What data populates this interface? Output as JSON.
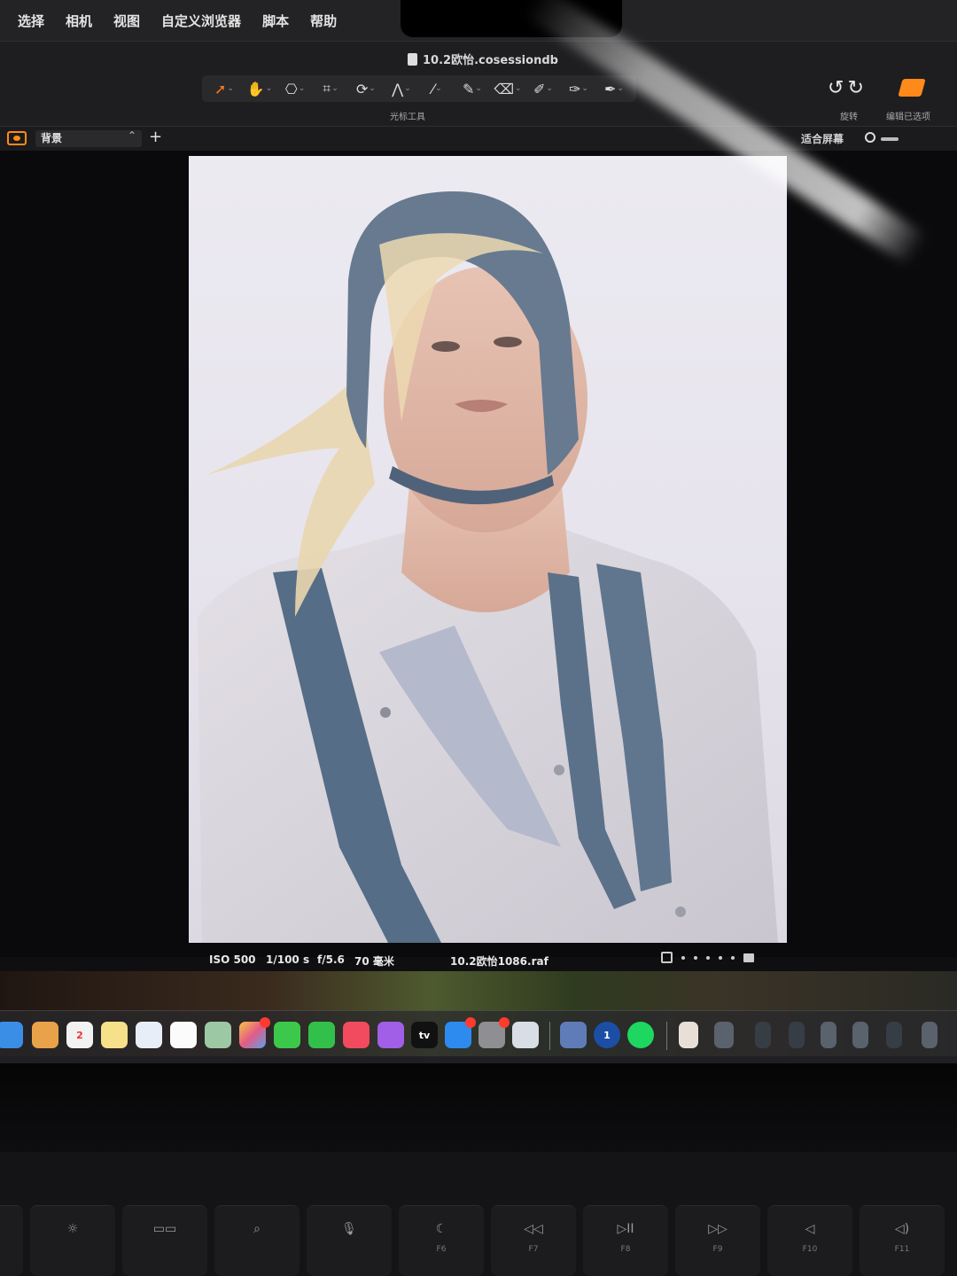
{
  "menubar": {
    "items": [
      "选择",
      "相机",
      "视图",
      "自定义浏览器",
      "脚本",
      "帮助"
    ]
  },
  "document": {
    "title": "10.2欧怡.cosessiondb"
  },
  "toolbar": {
    "tools": [
      "cursor-tool-icon",
      "hand-tool-icon",
      "loupe-tool-icon",
      "crop-tool-icon",
      "rotate-tool-icon",
      "keystone-tool-icon",
      "picker-tool-icon",
      "brush-tool-icon",
      "eraser-tool-icon",
      "gradient-tool-icon",
      "linear-mask-icon",
      "pen-tool-icon"
    ],
    "caption": "光标工具",
    "rotate_caption": "旋转",
    "edit_caption": "编辑已选项"
  },
  "layers": {
    "current": "背景",
    "add": "+"
  },
  "viewer": {
    "fit_label": "适合屏幕"
  },
  "capture": {
    "iso": "ISO 500",
    "shutter": "1/100 s",
    "aperture": "f/5.6",
    "focal": "70 毫米",
    "filename": "10.2欧怡1086.raf"
  },
  "dock": {
    "apps": [
      "Mail",
      "Finder",
      "Calendar",
      "Notes",
      "Freeform",
      "Reminders",
      "Maps",
      "Photos",
      "Messages",
      "FaceTime",
      "Music",
      "Podcasts",
      "TV",
      "App Store",
      "System Settings",
      "Preview",
      "Capture One",
      "1Password",
      "Spotify",
      "iPhone Mirroring"
    ],
    "calendar_day": "2",
    "tv_label": "tv",
    "password_label": "1"
  },
  "keyboard": {
    "keys": [
      {
        "glyph": "☼",
        "label": ""
      },
      {
        "glyph": "☼",
        "label": ""
      },
      {
        "glyph": "▭▭",
        "label": ""
      },
      {
        "glyph": "⌕",
        "label": ""
      },
      {
        "glyph": "🎙",
        "label": ""
      },
      {
        "glyph": "☾",
        "label": "F6"
      },
      {
        "glyph": "◁◁",
        "label": "F7"
      },
      {
        "glyph": "▷II",
        "label": "F8"
      },
      {
        "glyph": "▷▷",
        "label": "F9"
      },
      {
        "glyph": "◁",
        "label": "F10"
      },
      {
        "glyph": "◁)",
        "label": "F11"
      }
    ]
  },
  "colors": {
    "accent": "#ff8a1c",
    "app_bg": "#1e1e20",
    "canvas_bg": "#0a0a0c"
  }
}
